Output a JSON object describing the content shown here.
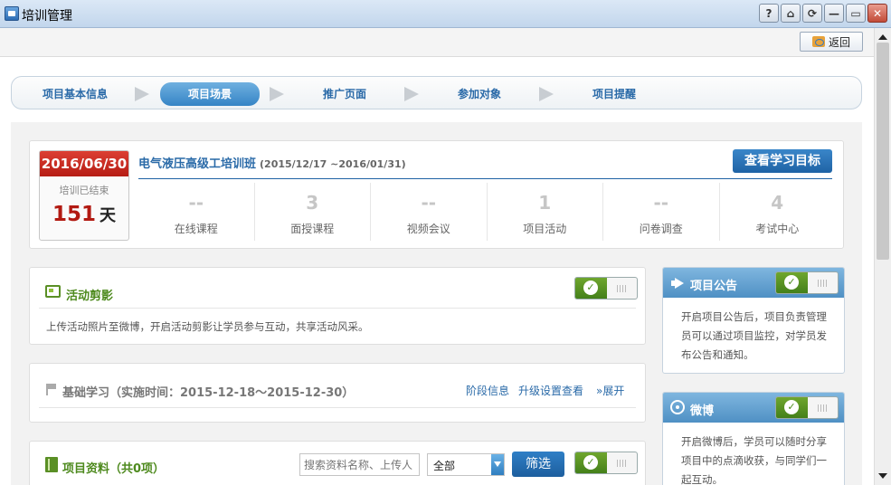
{
  "window": {
    "title": "培训管理",
    "buttons": [
      "?",
      "⌂",
      "⟳",
      "—",
      "▭",
      "✕"
    ]
  },
  "toolbar": {
    "back_label": "返回"
  },
  "steps": [
    {
      "label": "项目基本信息",
      "active": false
    },
    {
      "label": "项目场景",
      "active": true
    },
    {
      "label": "推广页面",
      "active": false
    },
    {
      "label": "参加对象",
      "active": false
    },
    {
      "label": "项目提醒",
      "active": false
    }
  ],
  "summary": {
    "date": "2016/06/30",
    "status": "培训已结束",
    "days": "151",
    "days_unit": "天",
    "course_name": "电气液压高级工培训班",
    "course_range": "(2015/12/17 ~2016/01/31)",
    "goal_button": "查看学习目标",
    "stats": [
      {
        "value": "--",
        "label": "在线课程"
      },
      {
        "value": "3",
        "label": "面授课程"
      },
      {
        "value": "--",
        "label": "视频会议"
      },
      {
        "value": "1",
        "label": "项目活动"
      },
      {
        "value": "--",
        "label": "问卷调查"
      },
      {
        "value": "4",
        "label": "考试中心"
      }
    ]
  },
  "activity": {
    "title": "活动剪影",
    "desc": "上传活动照片至微博，开启活动剪影让学员参与互动，共享活动风采。"
  },
  "basic_study": {
    "title": "基础学习（实施时间：2015-12-18～2015-12-30）",
    "link_stage": "阶段信息",
    "link_upgrade": "升级设置查看",
    "link_expand": "展开"
  },
  "materials": {
    "title": "项目资料（共0项）",
    "search_placeholder": "搜索资料名称、上传人",
    "select_value": "全部",
    "filter_label": "筛选"
  },
  "announce": {
    "title": "项目公告",
    "desc": "开启项目公告后，项目负责管理员可以通过项目监控，对学员发布公告和通知。"
  },
  "weibo": {
    "title": "微博",
    "desc": "开启微博后，学员可以随时分享项目中的点滴收获，与同学们一起互动。"
  }
}
